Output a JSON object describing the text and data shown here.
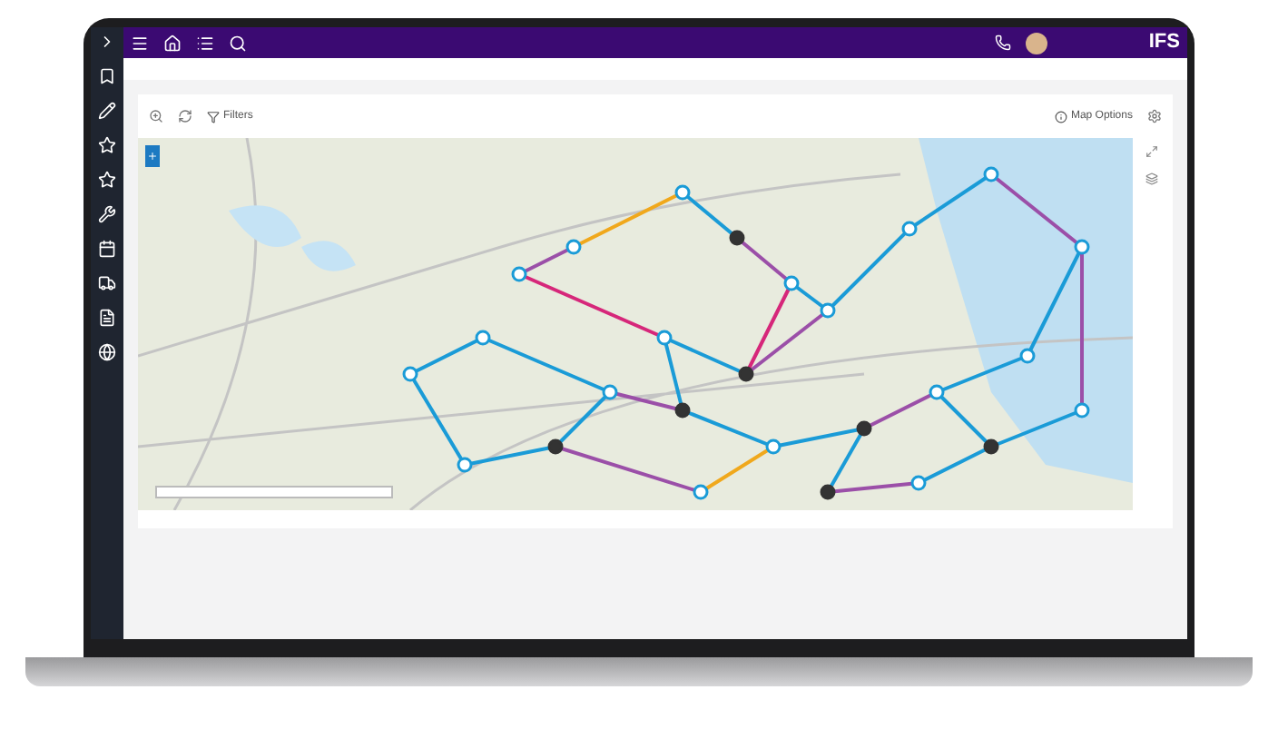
{
  "header": {
    "logo": "IFS"
  },
  "toolbar": {
    "buttons": [
      {
        "label": "Filters",
        "kind": "filter"
      },
      {
        "label": "Map Options",
        "kind": "options"
      }
    ]
  }
}
